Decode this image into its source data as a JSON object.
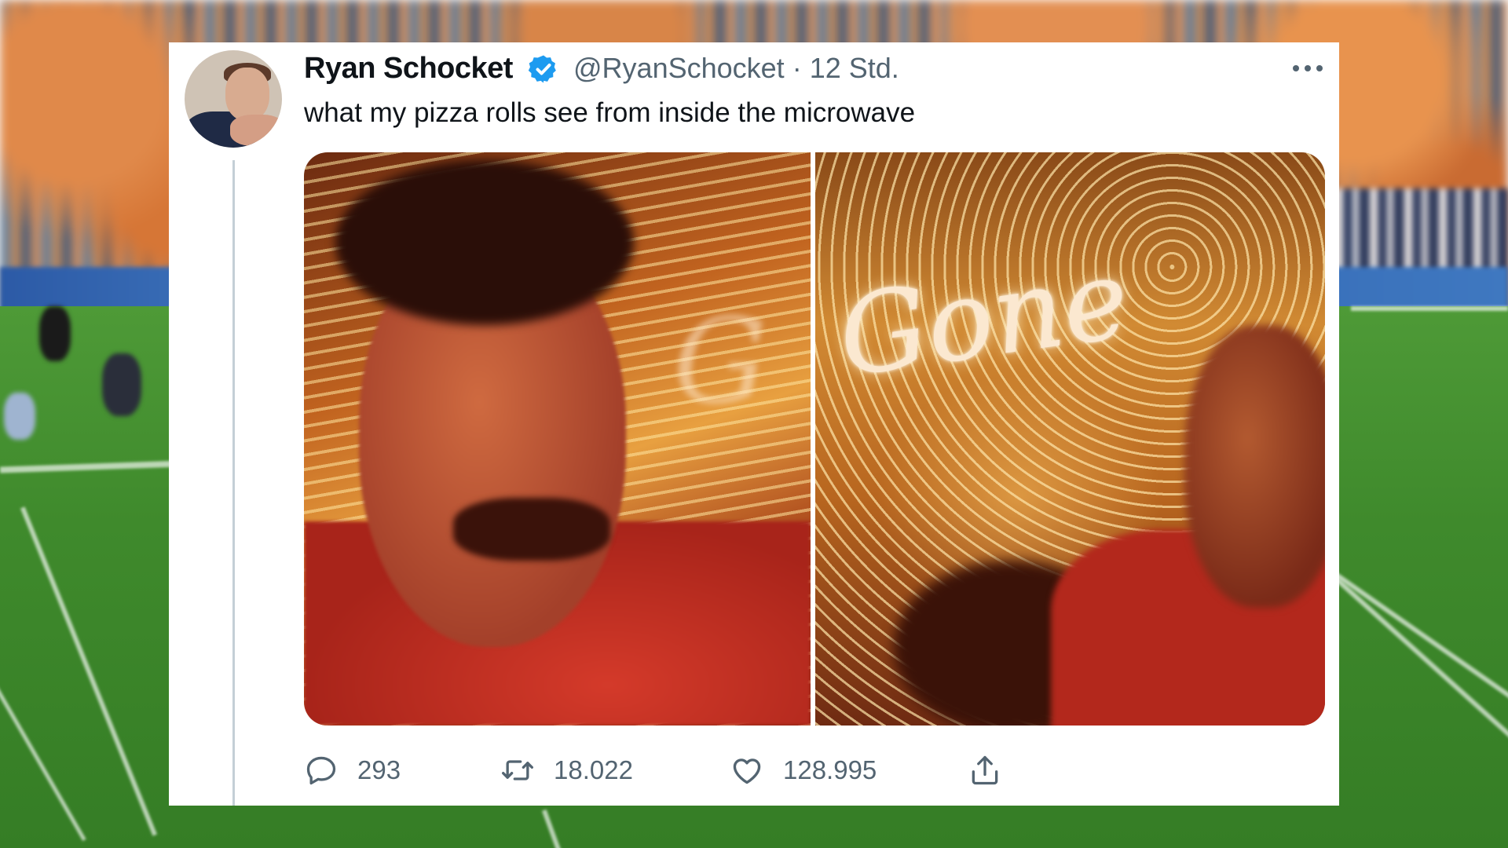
{
  "tweet": {
    "display_name": "Ryan Schocket",
    "handle": "@RyanSchocket",
    "separator": "·",
    "time": "12 Std.",
    "text": "what my pizza rolls see from inside the microwave",
    "image_text": "Gone",
    "stats": {
      "replies": "293",
      "retweets": "18.022",
      "likes": "128.995"
    }
  },
  "colors": {
    "verified": "#1d9bf0",
    "icon_gray": "#536471",
    "text": "#0f1419"
  },
  "icons": [
    "verified-badge-icon",
    "more-icon",
    "reply-icon",
    "retweet-icon",
    "like-icon",
    "share-icon"
  ]
}
